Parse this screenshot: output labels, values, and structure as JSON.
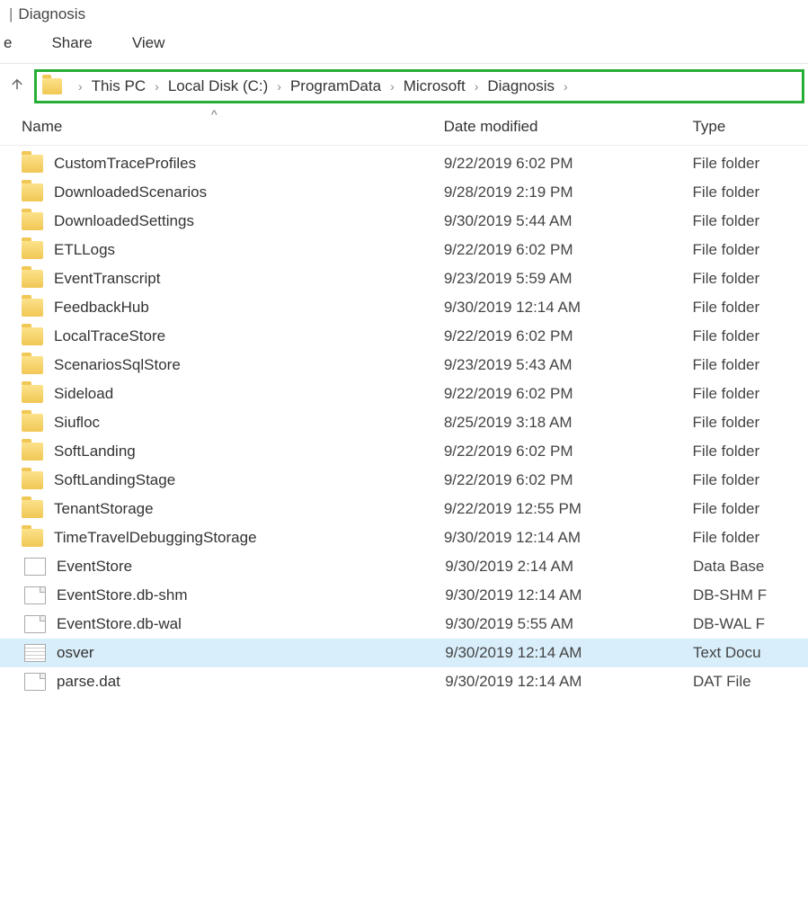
{
  "window": {
    "title": "Diagnosis"
  },
  "ribbon": {
    "tabs": [
      {
        "label": "e"
      },
      {
        "label": "Share"
      },
      {
        "label": "View"
      }
    ]
  },
  "breadcrumb": {
    "items": [
      "This PC",
      "Local Disk (C:)",
      "ProgramData",
      "Microsoft",
      "Diagnosis"
    ]
  },
  "columns": {
    "name": "Name",
    "date": "Date modified",
    "type": "Type",
    "sort_caret": "^"
  },
  "items": [
    {
      "icon": "folder",
      "name": "CustomTraceProfiles",
      "date": "9/22/2019 6:02 PM",
      "type": "File folder",
      "selected": false
    },
    {
      "icon": "folder",
      "name": "DownloadedScenarios",
      "date": "9/28/2019 2:19 PM",
      "type": "File folder",
      "selected": false
    },
    {
      "icon": "folder",
      "name": "DownloadedSettings",
      "date": "9/30/2019 5:44 AM",
      "type": "File folder",
      "selected": false
    },
    {
      "icon": "folder",
      "name": "ETLLogs",
      "date": "9/22/2019 6:02 PM",
      "type": "File folder",
      "selected": false
    },
    {
      "icon": "folder",
      "name": "EventTranscript",
      "date": "9/23/2019 5:59 AM",
      "type": "File folder",
      "selected": false
    },
    {
      "icon": "folder",
      "name": "FeedbackHub",
      "date": "9/30/2019 12:14 AM",
      "type": "File folder",
      "selected": false
    },
    {
      "icon": "folder",
      "name": "LocalTraceStore",
      "date": "9/22/2019 6:02 PM",
      "type": "File folder",
      "selected": false
    },
    {
      "icon": "folder",
      "name": "ScenariosSqlStore",
      "date": "9/23/2019 5:43 AM",
      "type": "File folder",
      "selected": false
    },
    {
      "icon": "folder",
      "name": "Sideload",
      "date": "9/22/2019 6:02 PM",
      "type": "File folder",
      "selected": false
    },
    {
      "icon": "folder",
      "name": "Siufloc",
      "date": "8/25/2019 3:18 AM",
      "type": "File folder",
      "selected": false
    },
    {
      "icon": "folder",
      "name": "SoftLanding",
      "date": "9/22/2019 6:02 PM",
      "type": "File folder",
      "selected": false
    },
    {
      "icon": "folder",
      "name": "SoftLandingStage",
      "date": "9/22/2019 6:02 PM",
      "type": "File folder",
      "selected": false
    },
    {
      "icon": "folder",
      "name": "TenantStorage",
      "date": "9/22/2019 12:55 PM",
      "type": "File folder",
      "selected": false
    },
    {
      "icon": "folder",
      "name": "TimeTravelDebuggingStorage",
      "date": "9/30/2019 12:14 AM",
      "type": "File folder",
      "selected": false
    },
    {
      "icon": "db",
      "name": "EventStore",
      "date": "9/30/2019 2:14 AM",
      "type": "Data Base",
      "selected": false
    },
    {
      "icon": "file",
      "name": "EventStore.db-shm",
      "date": "9/30/2019 12:14 AM",
      "type": "DB-SHM F",
      "selected": false
    },
    {
      "icon": "file",
      "name": "EventStore.db-wal",
      "date": "9/30/2019 5:55 AM",
      "type": "DB-WAL F",
      "selected": false
    },
    {
      "icon": "textdoc",
      "name": "osver",
      "date": "9/30/2019 12:14 AM",
      "type": "Text Docu",
      "selected": true
    },
    {
      "icon": "file",
      "name": "parse.dat",
      "date": "9/30/2019 12:14 AM",
      "type": "DAT File",
      "selected": false
    }
  ]
}
